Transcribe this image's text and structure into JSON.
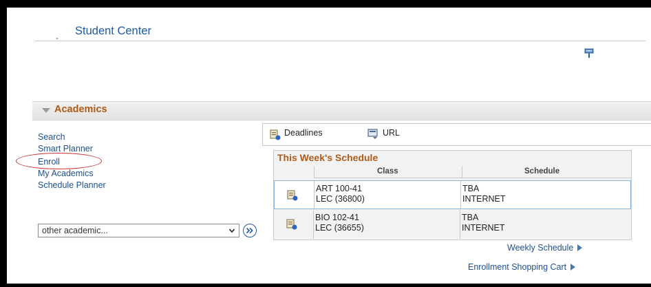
{
  "header": {
    "title": "Student Center"
  },
  "academics": {
    "title": "Academics",
    "links": [
      "Search",
      "Smart Planner",
      "Enroll",
      "My Academics",
      "Schedule Planner"
    ],
    "select": {
      "value": "other academic..."
    }
  },
  "quick_links": {
    "deadlines": "Deadlines",
    "url": "URL"
  },
  "schedule": {
    "heading": "This Week's Schedule",
    "columns": [
      "Class",
      "Schedule"
    ],
    "rows": [
      {
        "class_line1": "ART 100-41",
        "class_line2": "LEC (36800)",
        "sched_line1": "TBA",
        "sched_line2": "INTERNET"
      },
      {
        "class_line1": "BIO 102-41",
        "class_line2": "LEC (36655)",
        "sched_line1": "TBA",
        "sched_line2": "INTERNET"
      }
    ]
  },
  "footer": {
    "weekly": "Weekly Schedule",
    "cart": "Enrollment Shopping Cart"
  },
  "colors": {
    "link": "#1d4f8e",
    "accent": "#b05a17",
    "annotation": "#c83232"
  }
}
